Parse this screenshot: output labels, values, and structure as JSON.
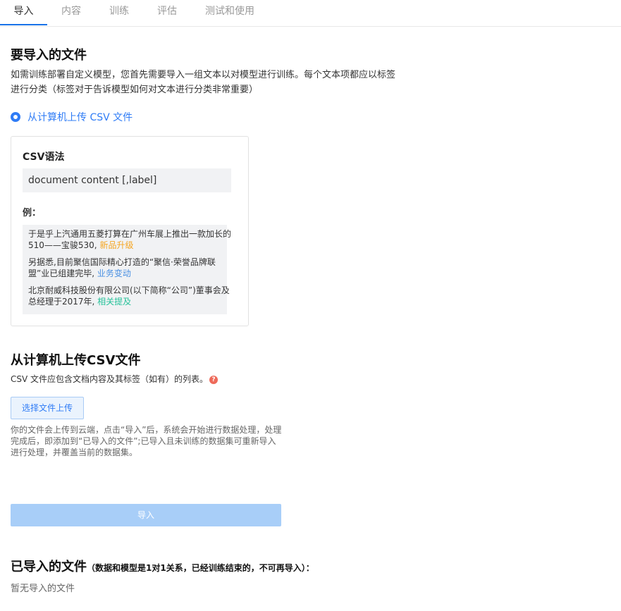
{
  "tabs": [
    {
      "label": "导入",
      "active": true
    },
    {
      "label": "内容"
    },
    {
      "label": "训练"
    },
    {
      "label": "评估"
    },
    {
      "label": "测试和使用"
    }
  ],
  "section_import": {
    "title": "要导入的文件",
    "desc_line1": "如需训练部署自定义模型，您首先需要导入一组文本以对模型进行训练。每个文本项都应以标签",
    "desc_line2": "进行分类（标签对于告诉模型如何对文本进行分类非常重要）",
    "radio_label": "从计算机上传 CSV 文件"
  },
  "csv_card": {
    "title": "CSV语法",
    "syntax": "document content [,label]",
    "example_title": "例：",
    "examples": [
      {
        "line1": "于是乎上汽通用五菱打算在广州车展上推出一款加长的",
        "line2": "510——宝骏530, ",
        "tag": "新品升级",
        "tag_color": "#f5a623"
      },
      {
        "line1": "另据悉,目前聚信国际精心打造的“聚信·荣誉品牌联",
        "line2": "盟”业已组建完毕, ",
        "tag": "业务变动",
        "tag_color": "#4a90e2"
      },
      {
        "line1": "北京耐威科技股份有限公司(以下简称“公司”)董事会及",
        "line2": "总经理于2017年, ",
        "tag": "相关提及",
        "tag_color": "#27c29a"
      }
    ]
  },
  "upload_section": {
    "title": "从计算机上传CSV文件",
    "desc": "CSV 文件应包含文档内容及其标签（如有）的列表。",
    "help_icon": "?",
    "button_label": "选择文件上传",
    "note": "你的文件会上传到云端，点击“导入”后，系统会开始进行数据处理，处理完成后，即添加到“已导入的文件”;已导入且未训练的数据集可重新导入进行处理，并覆盖当前的数据集。"
  },
  "import_button": "导入",
  "imported": {
    "title": "已导入的文件",
    "subtitle": "（数据和模型是1对1关系，已经训练结束的，不可再导入）：",
    "empty": "暂无导入的文件"
  },
  "colors": {
    "accent": "#2f7cf6",
    "tab_underline": "#1a73e8",
    "import_button": "#a8cef8",
    "help_icon": "#ee6a5a"
  }
}
